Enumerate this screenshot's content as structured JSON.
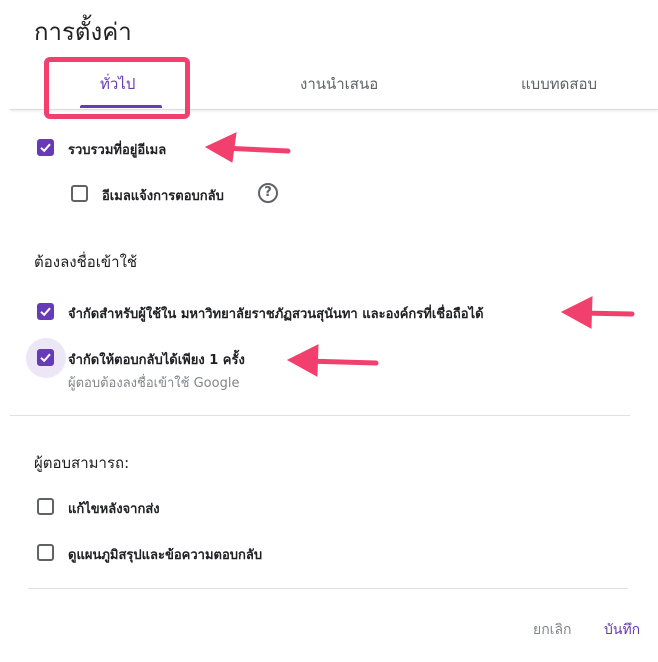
{
  "dialog": {
    "title": "การตั้งค่า"
  },
  "tabs": [
    {
      "label": "ทั่วไป",
      "active": true
    },
    {
      "label": "งานนำเสนอ",
      "active": false
    },
    {
      "label": "แบบทดสอบ",
      "active": false
    }
  ],
  "general": {
    "collect_email": {
      "label": "รวบรวมที่อยู่อีเมล",
      "checked": true
    },
    "email_receipt": {
      "label": "อีเมลแจ้งการตอบกลับ",
      "checked": false,
      "help_icon": "?"
    }
  },
  "requires_signin": {
    "heading": "ต้องลงชื่อเข้าใช้",
    "restrict_org": {
      "label": "จำกัดสำหรับผู้ใช้ใน มหาวิทยาลัยราชภัฏสวนสุนันทา และองค์กรที่เชื่อถือได้",
      "checked": true
    },
    "limit_one": {
      "label": "จำกัดให้ตอบกลับได้เพียง 1 ครั้ง",
      "sublabel": "ผู้ตอบต้องลงชื่อเข้าใช้ Google",
      "checked": true
    }
  },
  "respondents": {
    "heading": "ผู้ตอบสามารถ:",
    "edit_after": {
      "label": "แก้ไขหลังจากส่ง",
      "checked": false
    },
    "see_summary": {
      "label": "ดูแผนภูมิสรุปและข้อความตอบกลับ",
      "checked": false
    }
  },
  "actions": {
    "cancel": "ยกเลิก",
    "save": "บันทึก"
  },
  "colors": {
    "accent": "#673ab7",
    "annotation": "#f2406e"
  }
}
